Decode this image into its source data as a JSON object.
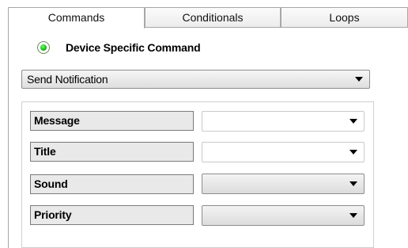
{
  "tabs": [
    {
      "label": "Commands",
      "active": true
    },
    {
      "label": "Conditionals",
      "active": false
    },
    {
      "label": "Loops",
      "active": false
    }
  ],
  "command_type": {
    "label": "Device Specific Command",
    "selected": true,
    "accent_color": "#0ba80b"
  },
  "command_select": {
    "value": "Send Notification",
    "icon": "chevron-down-icon"
  },
  "parameters": [
    {
      "label": "Message",
      "value": "",
      "enabled": true
    },
    {
      "label": "Title",
      "value": "",
      "enabled": true
    },
    {
      "label": "Sound",
      "value": "",
      "enabled": false
    },
    {
      "label": "Priority",
      "value": "",
      "enabled": false
    }
  ]
}
